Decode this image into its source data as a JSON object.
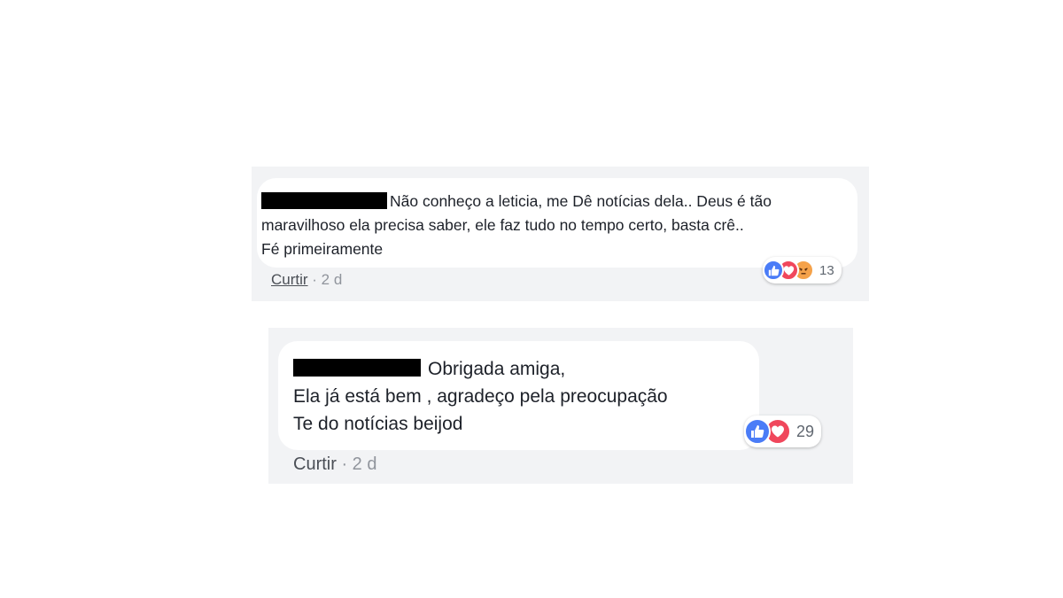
{
  "comments": [
    {
      "author": "",
      "text_lines": [
        "Não conheço a leticia, me Dê notícias dela.. Deus é tão",
        "maravilhoso ela precisa saber, ele faz tudo no tempo certo, basta crê..",
        "Fé primeiramente"
      ],
      "reactions": [
        "like-icon",
        "love-icon",
        "angry-icon"
      ],
      "reaction_count": "13",
      "like_label": "Curtir",
      "separator": " · ",
      "time": "2 d"
    },
    {
      "author": "",
      "text_lines": [
        "Obrigada amiga,",
        "Ela já está bem , agradeço pela preocupação",
        "Te do notícias beijod"
      ],
      "reactions": [
        "like-icon",
        "love-icon"
      ],
      "reaction_count": "29",
      "like_label": "Curtir",
      "separator": " · ",
      "time": "2 d"
    }
  ],
  "colors": {
    "like": "#4a7cf7",
    "love": "#f0475c",
    "angry": "#f5a24a",
    "panel": "#f2f3f5",
    "text": "#1d2129",
    "meta": "#90949c"
  }
}
